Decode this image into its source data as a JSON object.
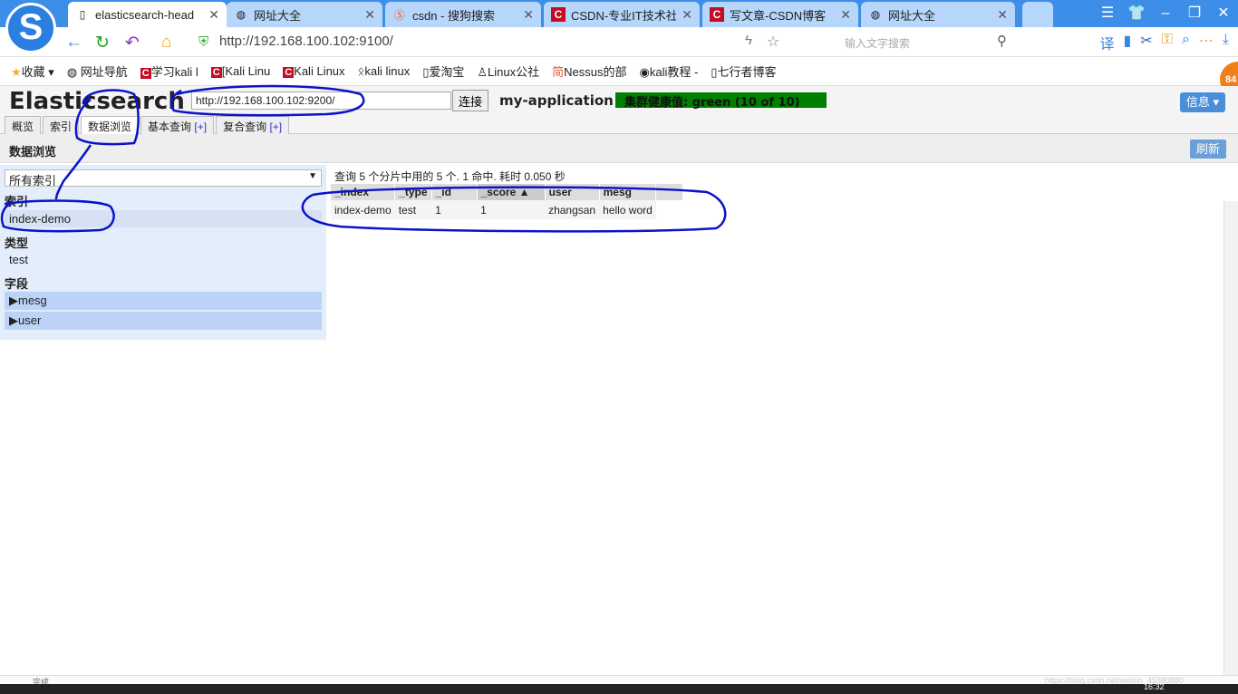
{
  "browser": {
    "tabs": [
      {
        "title": "elasticsearch-head",
        "icon": "page-icon",
        "active": true
      },
      {
        "title": "网址大全",
        "icon": "globe-icon"
      },
      {
        "title": "csdn - 搜狗搜索",
        "icon": "sogou-icon"
      },
      {
        "title": "CSDN-专业IT技术社区",
        "icon": "csdn-icon"
      },
      {
        "title": "写文章-CSDN博客",
        "icon": "csdn-icon"
      },
      {
        "title": "网址大全",
        "icon": "globe-icon"
      }
    ],
    "url": "http://192.168.100.102:9100/",
    "search_placeholder": "输入文字搜索",
    "bookmarks": [
      "收藏",
      "网址导航",
      "学习kali l",
      "[Kali Linu",
      "Kali Linux",
      "kali linux",
      "爱淘宝",
      "Linux公社",
      "Nessus的部",
      "kali教程 -",
      "七行者博客"
    ],
    "badge": "84",
    "status_text": "完成",
    "clock": "16:32",
    "watermark": "https://blog.csdn.net/weixin_45380880"
  },
  "app": {
    "title": "Elasticsearch",
    "connect_url": "http://192.168.100.102:9200/",
    "connect_label": "连接",
    "cluster_name": "my-application",
    "health": "集群健康值: green (10 of 10)",
    "health_color": "#008000",
    "info_label": "信息 ▾",
    "tabs": [
      {
        "label": "概览"
      },
      {
        "label": "索引"
      },
      {
        "label": "数据浏览",
        "active": true
      },
      {
        "label": "基本查询",
        "plus": "[+]"
      },
      {
        "label": "复合查询",
        "plus": "[+]"
      }
    ],
    "section_title": "数据浏览",
    "refresh_label": "刷新"
  },
  "browser_panel": {
    "index_select": "所有索引",
    "index_heading": "索引",
    "indices": [
      "index-demo"
    ],
    "type_heading": "类型",
    "types": [
      "test"
    ],
    "field_heading": "字段",
    "fields": [
      "mesg",
      "user"
    ]
  },
  "results": {
    "summary": "查询 5 个分片中用的 5 个. 1 命中. 耗时 0.050 秒",
    "columns": [
      "_index",
      "_type",
      "_id",
      "_score ▲",
      "user",
      "mesg"
    ],
    "rows": [
      [
        "index-demo",
        "test",
        "1",
        "1",
        "zhangsan",
        "hello word"
      ]
    ]
  }
}
